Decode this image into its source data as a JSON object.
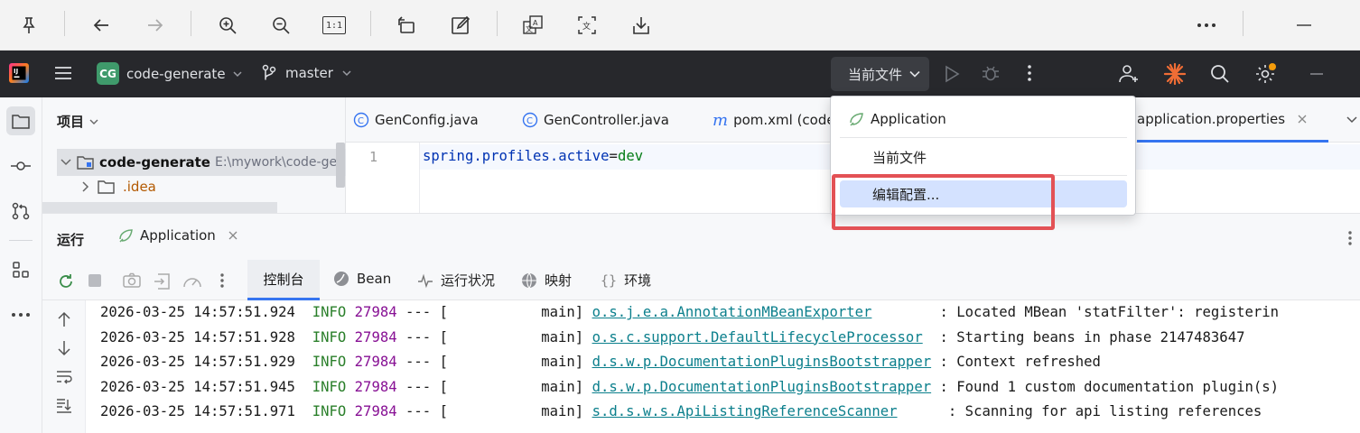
{
  "viewer_toolbar": {
    "icons": [
      "pin-icon",
      "back-arrow-icon",
      "forward-arrow-icon",
      "zoom-in-icon",
      "zoom-out-icon",
      "actual-size-icon",
      "rotate-icon",
      "edit-icon",
      "translate-icon",
      "ocr-icon",
      "save-icon",
      "more-icon",
      "minimize-icon"
    ],
    "actual_size_label": "1:1"
  },
  "header": {
    "project_badge": "CG",
    "project_name": "code-generate",
    "branch": "master",
    "run_config": "当前文件"
  },
  "project_panel": {
    "title": "项目",
    "root_name": "code-generate",
    "root_path": "E:\\mywork\\code-gen",
    "child": ".idea"
  },
  "editor": {
    "tabs": [
      {
        "label": "GenConfig.java"
      },
      {
        "label": "GenController.java"
      },
      {
        "label": "pom.xml (code"
      },
      {
        "label": "application.properties"
      }
    ],
    "line_number": "1",
    "code_key": "spring.profiles.active",
    "code_eq": "=",
    "code_val": "dev"
  },
  "dropdown": {
    "items": [
      "Application",
      "当前文件",
      "编辑配置..."
    ]
  },
  "run_panel": {
    "title": "运行",
    "tab_label": "Application",
    "subtabs": [
      "控制台",
      "Bean",
      "运行状况",
      "映射",
      "环境"
    ]
  },
  "console": {
    "lines": [
      {
        "ts": "2026-03-25 14:57:51.924",
        "level": "INFO",
        "pid": "27984",
        "sep": " --- [           main] ",
        "pkg": "o.s.j.e.a.",
        "cls": "AnnotationMBeanExporter",
        "pad": "        ",
        "msg": ": Located MBean 'statFilter': registerin"
      },
      {
        "ts": "2026-03-25 14:57:51.928",
        "level": "INFO",
        "pid": "27984",
        "sep": " --- [           main] ",
        "pkg": "o.s.c.support.",
        "cls": "DefaultLifecycleProcessor",
        "pad": "  ",
        "msg": ": Starting beans in phase 2147483647"
      },
      {
        "ts": "2026-03-25 14:57:51.929",
        "level": "INFO",
        "pid": "27984",
        "sep": " --- [           main] ",
        "pkg": "d.s.w.p.",
        "cls": "DocumentationPluginsBootstrapper",
        "pad": " ",
        "msg": ": Context refreshed"
      },
      {
        "ts": "2026-03-25 14:57:51.945",
        "level": "INFO",
        "pid": "27984",
        "sep": " --- [           main] ",
        "pkg": "d.s.w.p.",
        "cls": "DocumentationPluginsBootstrapper",
        "pad": " ",
        "msg": ": Found 1 custom documentation plugin(s)"
      },
      {
        "ts": "2026-03-25 14:57:51.971",
        "level": "INFO",
        "pid": "27984",
        "sep": " --- [           main] ",
        "pkg": "s.d.s.w.s.",
        "cls": "ApiListingReferenceScanner",
        "pad": "      ",
        "msg": ": Scanning for api listing references"
      }
    ]
  },
  "colors": {
    "header_bg": "#27282c",
    "highlight": "#d4e2ff",
    "annotation_red": "#e35155",
    "project_badge": "#3f9a6b"
  }
}
